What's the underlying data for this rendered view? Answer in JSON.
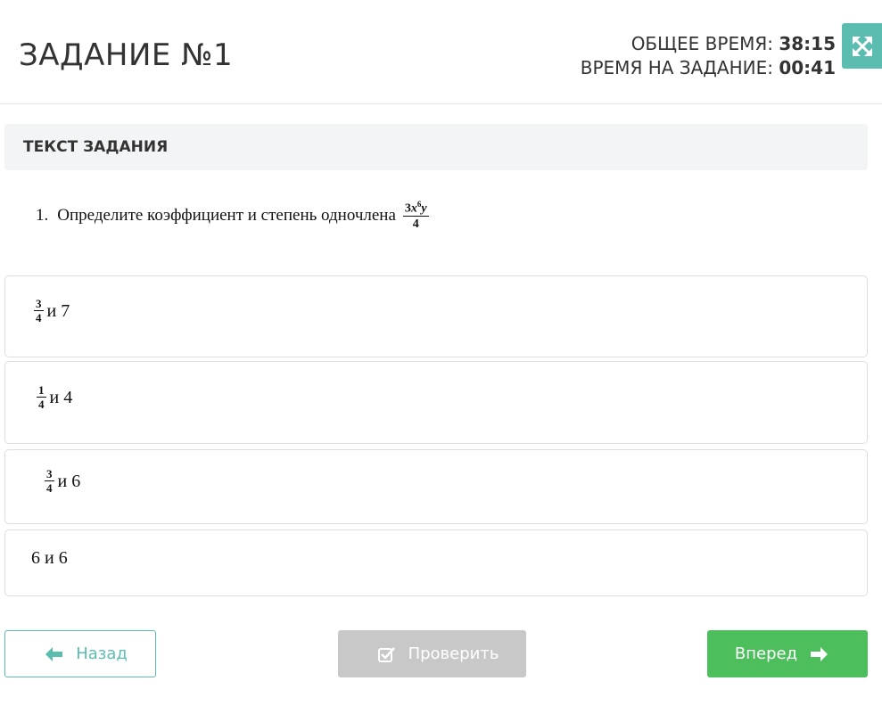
{
  "header": {
    "task_title": "ЗАДАНИЕ №1",
    "total_time_label": "ОБЩЕЕ ВРЕМЯ:",
    "total_time_value": "38:15",
    "task_time_label": "ВРЕМЯ НА ЗАДАНИЕ:",
    "task_time_value": "00:41",
    "fullscreen_icon": "expand-arrows-icon"
  },
  "task_panel": {
    "heading": "ТЕКСТ ЗАДАНИЯ"
  },
  "question": {
    "number": "1.",
    "text": "Определите коэффициент и степень одночлена",
    "fraction_numerator_coef": "3",
    "fraction_numerator_var1": "x",
    "fraction_numerator_exp": "6",
    "fraction_numerator_var2": "y",
    "fraction_denominator": "4"
  },
  "options": [
    {
      "numerator": "3",
      "denominator": "4",
      "rest": "и 7"
    },
    {
      "numerator": "1",
      "denominator": "4",
      "rest": "и 4"
    },
    {
      "numerator": "3",
      "denominator": "4",
      "rest": "и 6"
    },
    {
      "text": "6 и 6"
    }
  ],
  "buttons": {
    "back_label": "Назад",
    "check_label": "Проверить",
    "next_label": "Вперед"
  },
  "colors": {
    "accent_teal": "#5bbcb0",
    "next_green": "#4cbf5c",
    "disabled_gray": "#c8c8c8",
    "panel_bg": "#f3f4f6"
  }
}
